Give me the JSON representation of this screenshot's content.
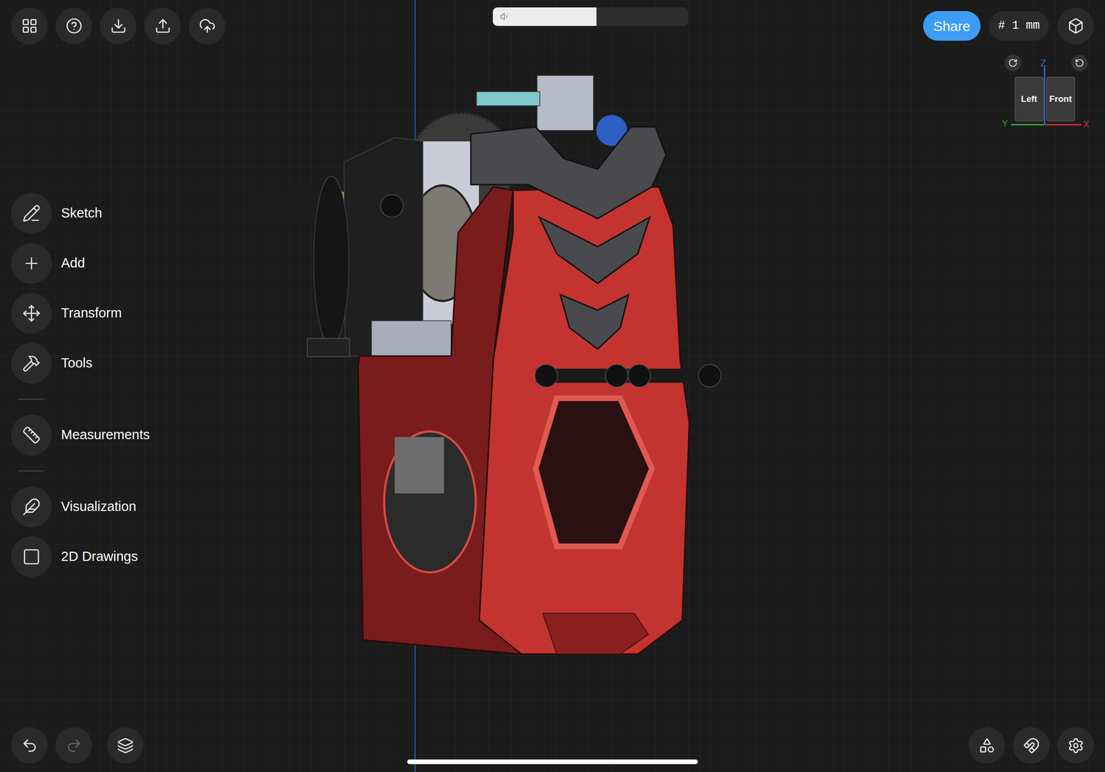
{
  "app": {
    "share_button": "Share",
    "grid_size": "# 1 mm"
  },
  "volume": {
    "level": 0.53
  },
  "menu_groups": [
    [
      "Sketch",
      "Add",
      "Transform",
      "Tools"
    ],
    [
      "Measurements"
    ],
    [
      "Visualization",
      "2D Drawings"
    ]
  ],
  "view_cube": {
    "faces": [
      "Left",
      "Front"
    ],
    "axes": {
      "z": "Z",
      "y": "Y",
      "x": "X"
    }
  },
  "history": {
    "undo_enabled": true,
    "redo_enabled": false
  }
}
